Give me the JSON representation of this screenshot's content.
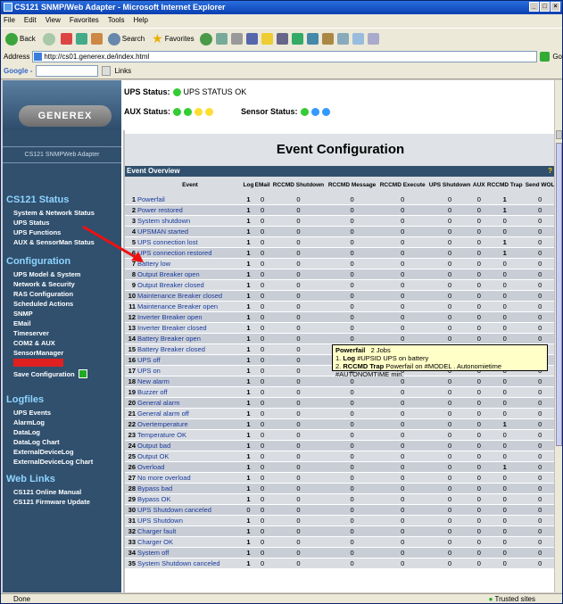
{
  "window": {
    "title": "CS121 SNMP/Web Adapter - Microsoft Internet Explorer"
  },
  "menu": [
    "File",
    "Edit",
    "View",
    "Favorites",
    "Tools",
    "Help"
  ],
  "toolbar": {
    "back": "Back",
    "search": "Search",
    "favorites": "Favorites"
  },
  "address": {
    "label": "Address",
    "url": "http://cs01.generex.de/index.html",
    "go": "Go"
  },
  "google": {
    "label": "Google -",
    "links": "Links"
  },
  "header": {
    "logo": "GENEREX",
    "ups_status_label": "UPS Status:",
    "ups_status_text": "UPS STATUS OK",
    "aux_status_label": "AUX Status:",
    "sensor_status_label": "Sensor Status:"
  },
  "sidebar": {
    "product": "CS121 SNMPWeb Adapter",
    "sections": [
      {
        "title": "CS121 Status",
        "items": [
          "System & Network Status",
          "UPS Status",
          "UPS Functions",
          "AUX & SensorMan Status"
        ]
      },
      {
        "title": "Configuration",
        "items": [
          "UPS Model & System",
          "Network & Security",
          "RAS Configuration",
          "Scheduled Actions",
          "SNMP",
          "EMail",
          "Timeserver",
          "COM2 & AUX",
          "SensorManager",
          "Events / Alarms",
          "Save Configuration"
        ]
      },
      {
        "title": "Logfiles",
        "items": [
          "UPS Events",
          "AlarmLog",
          "DataLog",
          "DataLog Chart",
          "ExternalDeviceLog",
          "ExternalDeviceLog Chart"
        ]
      },
      {
        "title": "Web Links",
        "items": [
          "CS121 Online Manual",
          "CS121 Firmware Update"
        ]
      }
    ]
  },
  "main": {
    "title": "Event Configuration",
    "overview": "Event Overview",
    "help": "?",
    "columns": [
      "",
      "Event",
      "Log",
      "EMail",
      "RCCMD Shutdown",
      "RCCMD Message",
      "RCCMD Execute",
      "UPS Shutdown",
      "AUX",
      "RCCMD Trap",
      "Send WOL"
    ],
    "rows": [
      [
        "1",
        "Powerfail",
        "1",
        "0",
        "0",
        "0",
        "0",
        "0",
        "0",
        "1",
        "0"
      ],
      [
        "2",
        "Power restored",
        "1",
        "0",
        "0",
        "0",
        "0",
        "0",
        "0",
        "1",
        "0"
      ],
      [
        "3",
        "System shutdown",
        "1",
        "0",
        "0",
        "0",
        "0",
        "0",
        "0",
        "0",
        "0"
      ],
      [
        "4",
        "UPSMAN started",
        "1",
        "0",
        "0",
        "0",
        "0",
        "0",
        "0",
        "0",
        "0"
      ],
      [
        "5",
        "UPS connection lost",
        "1",
        "0",
        "0",
        "0",
        "0",
        "0",
        "0",
        "1",
        "0"
      ],
      [
        "6",
        "UPS connection restored",
        "1",
        "0",
        "0",
        "0",
        "0",
        "0",
        "0",
        "1",
        "0"
      ],
      [
        "7",
        "Battery low",
        "1",
        "0",
        "0",
        "0",
        "0",
        "0",
        "0",
        "0",
        "0"
      ],
      [
        "8",
        "Output Breaker open",
        "1",
        "0",
        "0",
        "0",
        "0",
        "0",
        "0",
        "0",
        "0"
      ],
      [
        "9",
        "Output Breaker closed",
        "1",
        "0",
        "0",
        "0",
        "0",
        "0",
        "0",
        "0",
        "0"
      ],
      [
        "10",
        "Maintenance Breaker closed",
        "1",
        "0",
        "0",
        "0",
        "0",
        "0",
        "0",
        "0",
        "0"
      ],
      [
        "11",
        "Maintenance Breaker open",
        "1",
        "0",
        "0",
        "0",
        "0",
        "0",
        "0",
        "0",
        "0"
      ],
      [
        "12",
        "Inverter Breaker open",
        "1",
        "0",
        "0",
        "0",
        "0",
        "0",
        "0",
        "0",
        "0"
      ],
      [
        "13",
        "Inverter Breaker closed",
        "1",
        "0",
        "0",
        "0",
        "0",
        "0",
        "0",
        "0",
        "0"
      ],
      [
        "14",
        "Battery Breaker open",
        "1",
        "0",
        "0",
        "0",
        "0",
        "0",
        "0",
        "0",
        "0"
      ],
      [
        "15",
        "Battery Breaker closed",
        "1",
        "0",
        "0",
        "0",
        "0",
        "0",
        "0",
        "0",
        "0"
      ],
      [
        "16",
        "UPS off",
        "1",
        "0",
        "0",
        "0",
        "0",
        "0",
        "0",
        "0",
        "0"
      ],
      [
        "17",
        "UPS on",
        "1",
        "0",
        "0",
        "0",
        "0",
        "0",
        "0",
        "0",
        "0"
      ],
      [
        "18",
        "New alarm",
        "1",
        "0",
        "0",
        "0",
        "0",
        "0",
        "0",
        "0",
        "0"
      ],
      [
        "19",
        "Buzzer off",
        "1",
        "0",
        "0",
        "0",
        "0",
        "0",
        "0",
        "0",
        "0"
      ],
      [
        "20",
        "General alarm",
        "1",
        "0",
        "0",
        "0",
        "0",
        "0",
        "0",
        "0",
        "0"
      ],
      [
        "21",
        "General alarm off",
        "1",
        "0",
        "0",
        "0",
        "0",
        "0",
        "0",
        "0",
        "0"
      ],
      [
        "22",
        "Overtemperature",
        "1",
        "0",
        "0",
        "0",
        "0",
        "0",
        "0",
        "1",
        "0"
      ],
      [
        "23",
        "Temperature OK",
        "1",
        "0",
        "0",
        "0",
        "0",
        "0",
        "0",
        "0",
        "0"
      ],
      [
        "24",
        "Output bad",
        "1",
        "0",
        "0",
        "0",
        "0",
        "0",
        "0",
        "0",
        "0"
      ],
      [
        "25",
        "Output OK",
        "1",
        "0",
        "0",
        "0",
        "0",
        "0",
        "0",
        "0",
        "0"
      ],
      [
        "26",
        "Overload",
        "1",
        "0",
        "0",
        "0",
        "0",
        "0",
        "0",
        "1",
        "0"
      ],
      [
        "27",
        "No more overload",
        "1",
        "0",
        "0",
        "0",
        "0",
        "0",
        "0",
        "0",
        "0"
      ],
      [
        "28",
        "Bypass bad",
        "1",
        "0",
        "0",
        "0",
        "0",
        "0",
        "0",
        "0",
        "0"
      ],
      [
        "29",
        "Bypass OK",
        "1",
        "0",
        "0",
        "0",
        "0",
        "0",
        "0",
        "0",
        "0"
      ],
      [
        "30",
        "UPS Shutdown canceled",
        "0",
        "0",
        "0",
        "0",
        "0",
        "0",
        "0",
        "0",
        "0"
      ],
      [
        "31",
        "UPS Shutdown",
        "1",
        "0",
        "0",
        "0",
        "0",
        "0",
        "0",
        "0",
        "0"
      ],
      [
        "32",
        "Charger fault",
        "1",
        "0",
        "0",
        "0",
        "0",
        "0",
        "0",
        "0",
        "0"
      ],
      [
        "33",
        "Charger OK",
        "1",
        "0",
        "0",
        "0",
        "0",
        "0",
        "0",
        "0",
        "0"
      ],
      [
        "34",
        "System off",
        "1",
        "0",
        "0",
        "0",
        "0",
        "0",
        "0",
        "0",
        "0"
      ],
      [
        "35",
        "System Shutdown canceled",
        "1",
        "0",
        "0",
        "0",
        "0",
        "0",
        "0",
        "0",
        "0"
      ]
    ]
  },
  "tooltip": {
    "title": "Powerfail",
    "jobs": "2 Jobs",
    "line1_num": "1.",
    "line1_key": "Log",
    "line1_text": "#UPSID UPS on battery",
    "line2_num": "2.",
    "line2_key": "RCCMD Trap",
    "line2_text": "Powerfail on #MODEL . Autonomietime #AUTONOMTIME min."
  },
  "statusbar": {
    "left": "Done",
    "right": "Trusted sites"
  }
}
